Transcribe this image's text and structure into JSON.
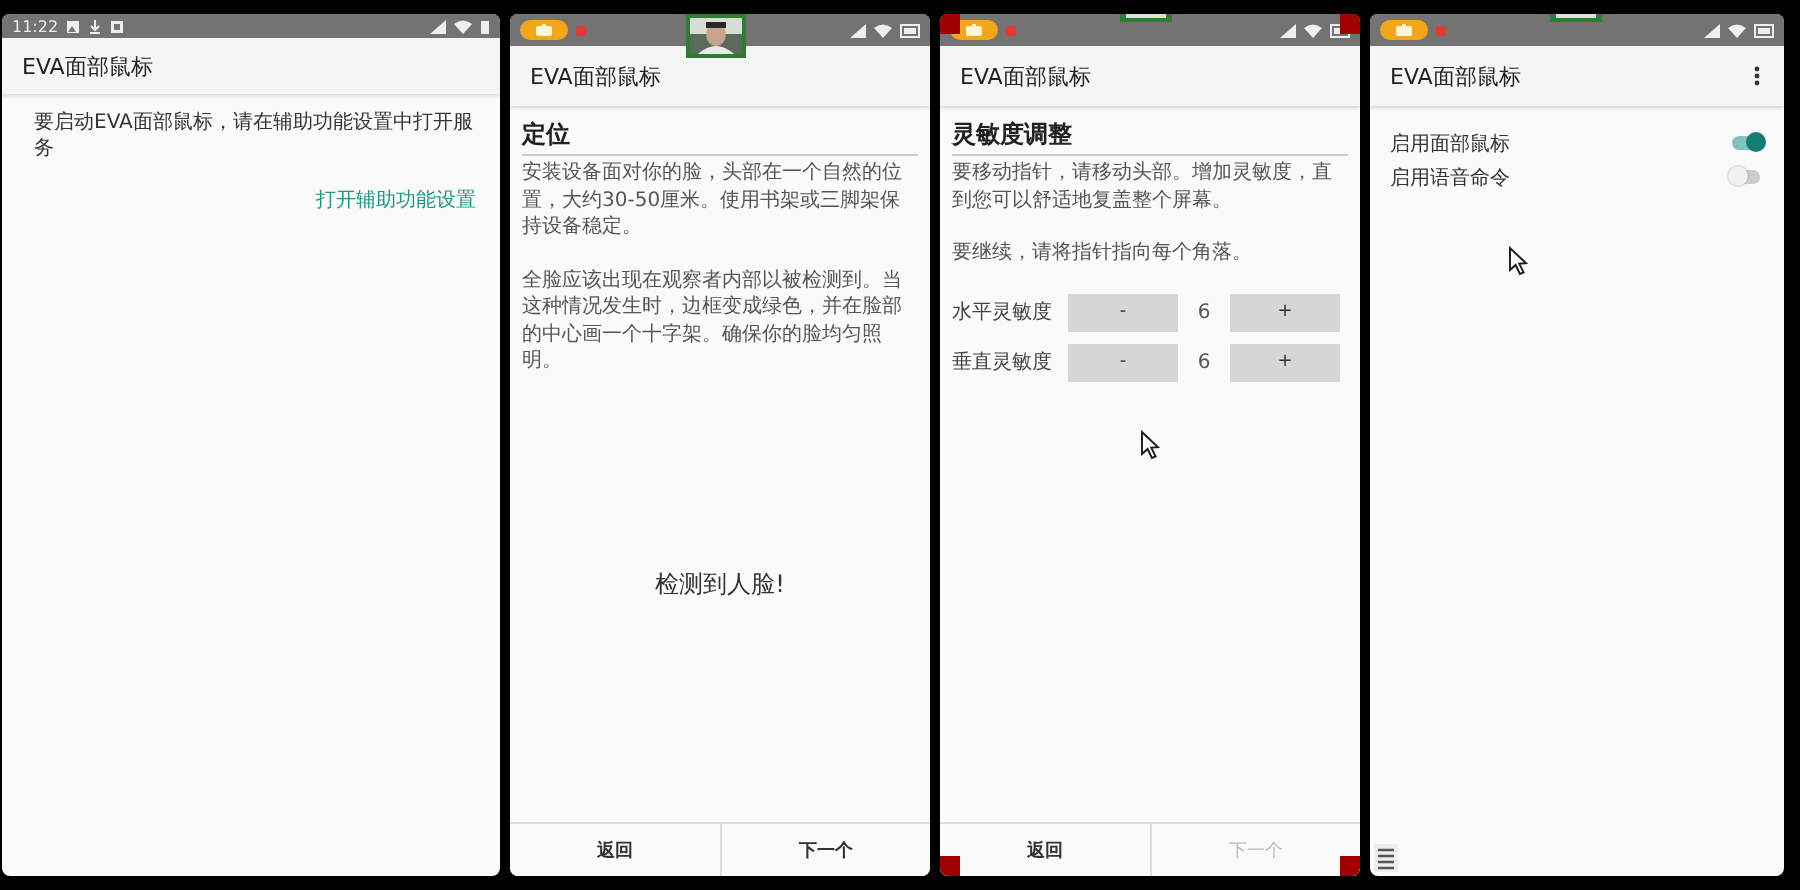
{
  "screens": [
    {
      "kind": "notice",
      "status_bar": {
        "time": "11:22"
      },
      "app_bar": {
        "title": "EVA面部鼠标"
      },
      "message": "要启动EVA面部鼠标，请在辅助功能设置中打开服务",
      "link": "打开辅助功能设置"
    },
    {
      "kind": "wizard",
      "status_bar": {
        "recording": true
      },
      "app_bar": {
        "title": "EVA面部鼠标"
      },
      "heading": "定位",
      "paragraphs": [
        "安装设备面对你的脸，头部在一个自然的位置，大约30-50厘米。使用书架或三脚架保持设备稳定。",
        "全脸应该出现在观察者内部以被检测到。当这种情况发生时，边框变成绿色，并在脸部的中心画一个十字架。确保你的脸均匀照明。"
      ],
      "status_text": "检测到人脸!",
      "nav": [
        {
          "label": "返回",
          "disabled": false
        },
        {
          "label": "下一个",
          "disabled": false
        }
      ]
    },
    {
      "kind": "wizard",
      "status_bar": {
        "recording": true
      },
      "camera_preview": {
        "kind": "edge"
      },
      "corner_markers": true,
      "cursor_visible": true,
      "app_bar": {
        "title": "EVA面部鼠标"
      },
      "heading": "灵敏度调整",
      "paragraphs": [
        "要移动指针，请移动头部。增加灵敏度，直到您可以舒适地复盖整个屏幕。",
        "要继续，请将指针指向每个角落。"
      ],
      "settings": [
        {
          "label": "水平灵敏度",
          "decrease": "-",
          "value": "6",
          "increase": "+"
        },
        {
          "label": "垂直灵敏度",
          "decrease": "-",
          "value": "6",
          "increase": "+"
        }
      ],
      "nav": [
        {
          "label": "返回",
          "disabled": false
        },
        {
          "label": "下一个",
          "disabled": true
        }
      ]
    },
    {
      "kind": "settings",
      "status_bar": {
        "recording": true
      },
      "camera_preview": {
        "kind": "edge"
      },
      "cursor_visible": true,
      "menu_button": true,
      "nav_menu_icon": true,
      "app_bar": {
        "title": "EVA面部鼠标"
      },
      "switches": [
        {
          "label": "启用面部鼠标",
          "on": true
        },
        {
          "label": "启用语音命令",
          "on": false
        }
      ]
    }
  ]
}
